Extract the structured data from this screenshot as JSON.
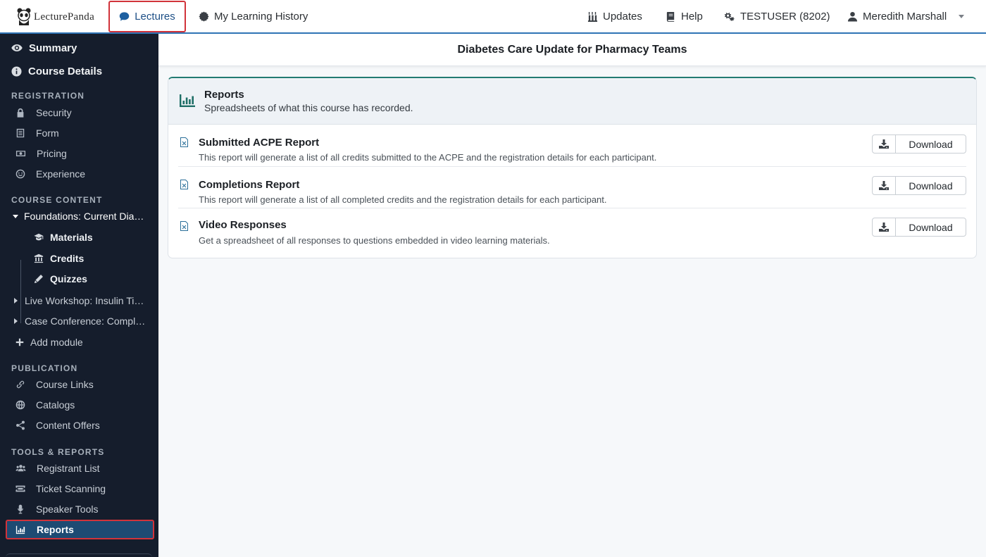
{
  "topbar": {
    "brand": "LecturePanda",
    "nav": {
      "lectures": "Lectures",
      "history": "My Learning History",
      "updates": "Updates",
      "help": "Help",
      "testuser": "TESTUSER (8202)",
      "user": "Meredith Marshall"
    }
  },
  "sidebar": {
    "summary": "Summary",
    "course_details": "Course Details",
    "sections": {
      "registration": "REGISTRATION",
      "course_content": "COURSE CONTENT",
      "publication": "PUBLICATION",
      "tools": "TOOLS & REPORTS"
    },
    "registration_items": [
      "Security",
      "Form",
      "Pricing",
      "Experience"
    ],
    "modules": [
      "Foundations: Current Diabetes Care",
      "Live Workshop: Insulin Titration",
      "Case Conference: Complex Cases"
    ],
    "module_children": [
      "Materials",
      "Credits",
      "Quizzes"
    ],
    "add_module": "Add module",
    "publication_items": [
      "Course Links",
      "Catalogs",
      "Content Offers"
    ],
    "tools_items": [
      "Registrant List",
      "Ticket Scanning",
      "Speaker Tools",
      "Reports"
    ]
  },
  "main": {
    "course_title": "Diabetes Care Update for Pharmacy Teams",
    "reports_card": {
      "title": "Reports",
      "subtitle": "Spreadsheets of what this course has recorded.",
      "download_label": "Download",
      "items": [
        {
          "title": "Submitted ACPE Report",
          "description": "This report will generate a list of all credits submitted to the ACPE and the registration details for each participant."
        },
        {
          "title": "Completions Report",
          "description": "This report will generate a list of all completed credits and the registration details for each participant."
        },
        {
          "title": "Video Responses",
          "description": "Get a spreadsheet of all responses to questions embedded in video learning materials."
        }
      ]
    }
  },
  "colors": {
    "sidebar_bg": "#151d2c",
    "active_item": "#1d4b73",
    "highlight_border": "#d1333a",
    "accent_teal": "#227b72",
    "topbar_line": "#2f74b5"
  }
}
